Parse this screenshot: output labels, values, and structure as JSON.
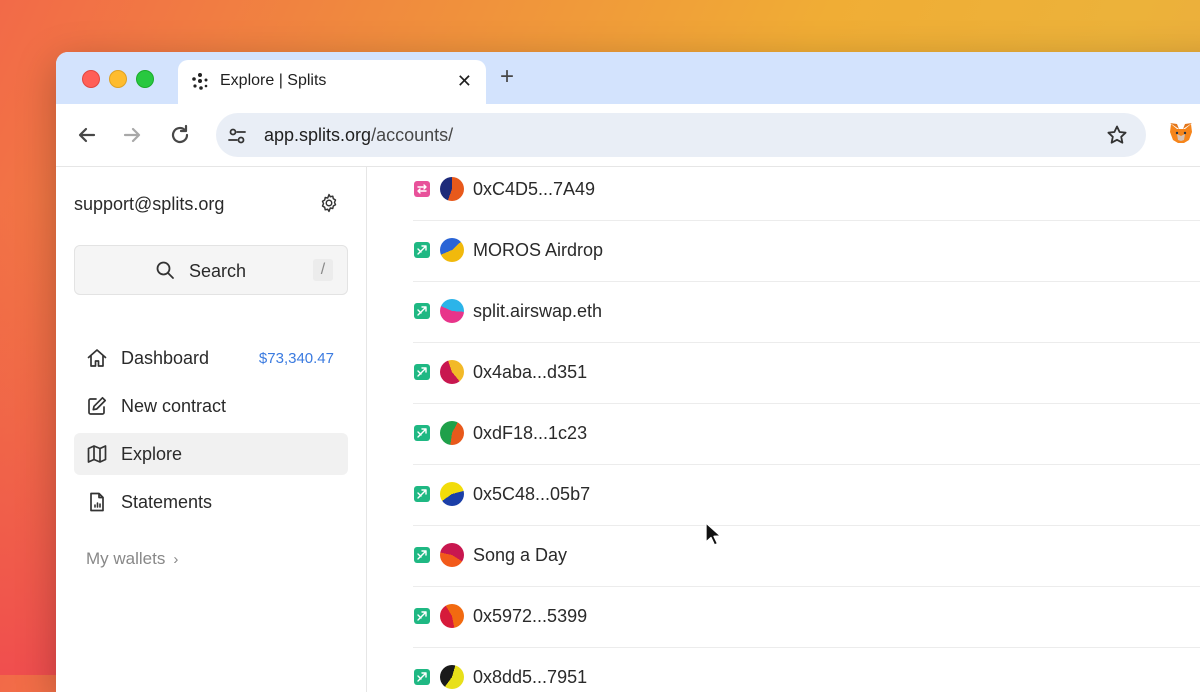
{
  "browser": {
    "tab_title": "Explore | Splits",
    "close_glyph": "✕",
    "new_tab_glyph": "+",
    "url_host": "app.splits.org",
    "url_path": "/accounts/"
  },
  "sidebar": {
    "account_email": "support@splits.org",
    "search_label": "Search",
    "search_shortcut": "/",
    "nav": [
      {
        "label": "Dashboard",
        "icon": "home-icon",
        "amount": "$73,340.47"
      },
      {
        "label": "New contract",
        "icon": "pencil-square-icon"
      },
      {
        "label": "Explore",
        "icon": "map-icon",
        "active": true
      },
      {
        "label": "Statements",
        "icon": "document-chart-icon"
      }
    ],
    "wallets_label": "My wallets",
    "wallets_chevron": "›"
  },
  "accounts": [
    {
      "name": "0xC4D5...7A49",
      "type": "swapper",
      "type_color": "#e8519a",
      "avatar_colors": [
        "#e8591b",
        "#1d2a7a"
      ]
    },
    {
      "name": "MOROS Airdrop",
      "type": "split",
      "type_color": "#1fb883",
      "avatar_colors": [
        "#f1b90c",
        "#2a64d6"
      ]
    },
    {
      "name": "split.airswap.eth",
      "type": "split",
      "type_color": "#1fb883",
      "avatar_colors": [
        "#e8348a",
        "#2bb4e9"
      ]
    },
    {
      "name": "0x4aba...d351",
      "type": "split",
      "type_color": "#1fb883",
      "avatar_colors": [
        "#c8174f",
        "#f2b928"
      ]
    },
    {
      "name": "0xdF18...1c23",
      "type": "split",
      "type_color": "#1fb883",
      "avatar_colors": [
        "#1fa04a",
        "#e8591b"
      ]
    },
    {
      "name": "0x5C48...05b7",
      "type": "split",
      "type_color": "#1fb883",
      "avatar_colors": [
        "#f2dc0a",
        "#1b3fa8"
      ]
    },
    {
      "name": "Song a Day",
      "type": "split",
      "type_color": "#1fb883",
      "avatar_colors": [
        "#c8174f",
        "#f25a1a"
      ]
    },
    {
      "name": "0x5972...5399",
      "type": "split",
      "type_color": "#1fb883",
      "avatar_colors": [
        "#f26a10",
        "#d61a3a"
      ]
    },
    {
      "name": "0x8dd5...7951",
      "type": "split",
      "type_color": "#1fb883",
      "avatar_colors": [
        "#e8e01a",
        "#1a1a1a"
      ]
    }
  ]
}
